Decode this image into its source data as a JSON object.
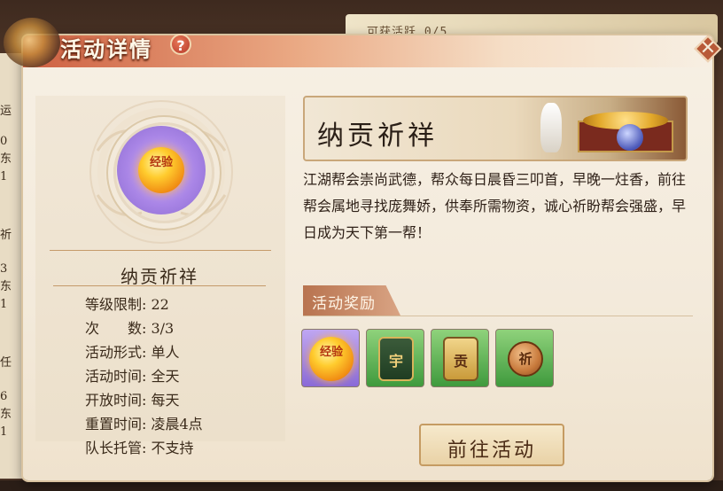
{
  "dialog": {
    "title": "活动详情",
    "help_symbol": "?",
    "close_symbol": "✕"
  },
  "background": {
    "top_strip_text": "可获活跃 0/5",
    "left_fragments": [
      "运",
      "0",
      "东",
      "1",
      "祈",
      "3",
      "东",
      "1",
      "任",
      "6",
      "东",
      "1"
    ]
  },
  "activity": {
    "icon_text": "经验",
    "name": "纳贡祈祥",
    "info": [
      "等级限制: 22",
      "次　　数: 3/3",
      "活动形式: 单人",
      "活动时间: 全天",
      "开放时间: 每天",
      "重置时间: 凌晨4点",
      "队长托管: 不支持"
    ],
    "banner_title": "纳贡祈祥",
    "description": "江湖帮会崇尚武德，帮众每日晨昏三叩首，早晚一炷香，前往帮会属地寻找庞舞娇，供奉所需物资，诚心祈盼帮会强盛，早日成为天下第一帮！"
  },
  "rewards": {
    "header": "活动奖励",
    "items": [
      {
        "name": "exp-orb",
        "glyph": "经验",
        "frame": "purple"
      },
      {
        "name": "token-scroll",
        "glyph": "宇",
        "frame": "green"
      },
      {
        "name": "token-plaque",
        "glyph": "贡",
        "frame": "green"
      },
      {
        "name": "coin",
        "glyph": "祈",
        "frame": "green"
      }
    ]
  },
  "actions": {
    "goto_label": "前往活动"
  }
}
